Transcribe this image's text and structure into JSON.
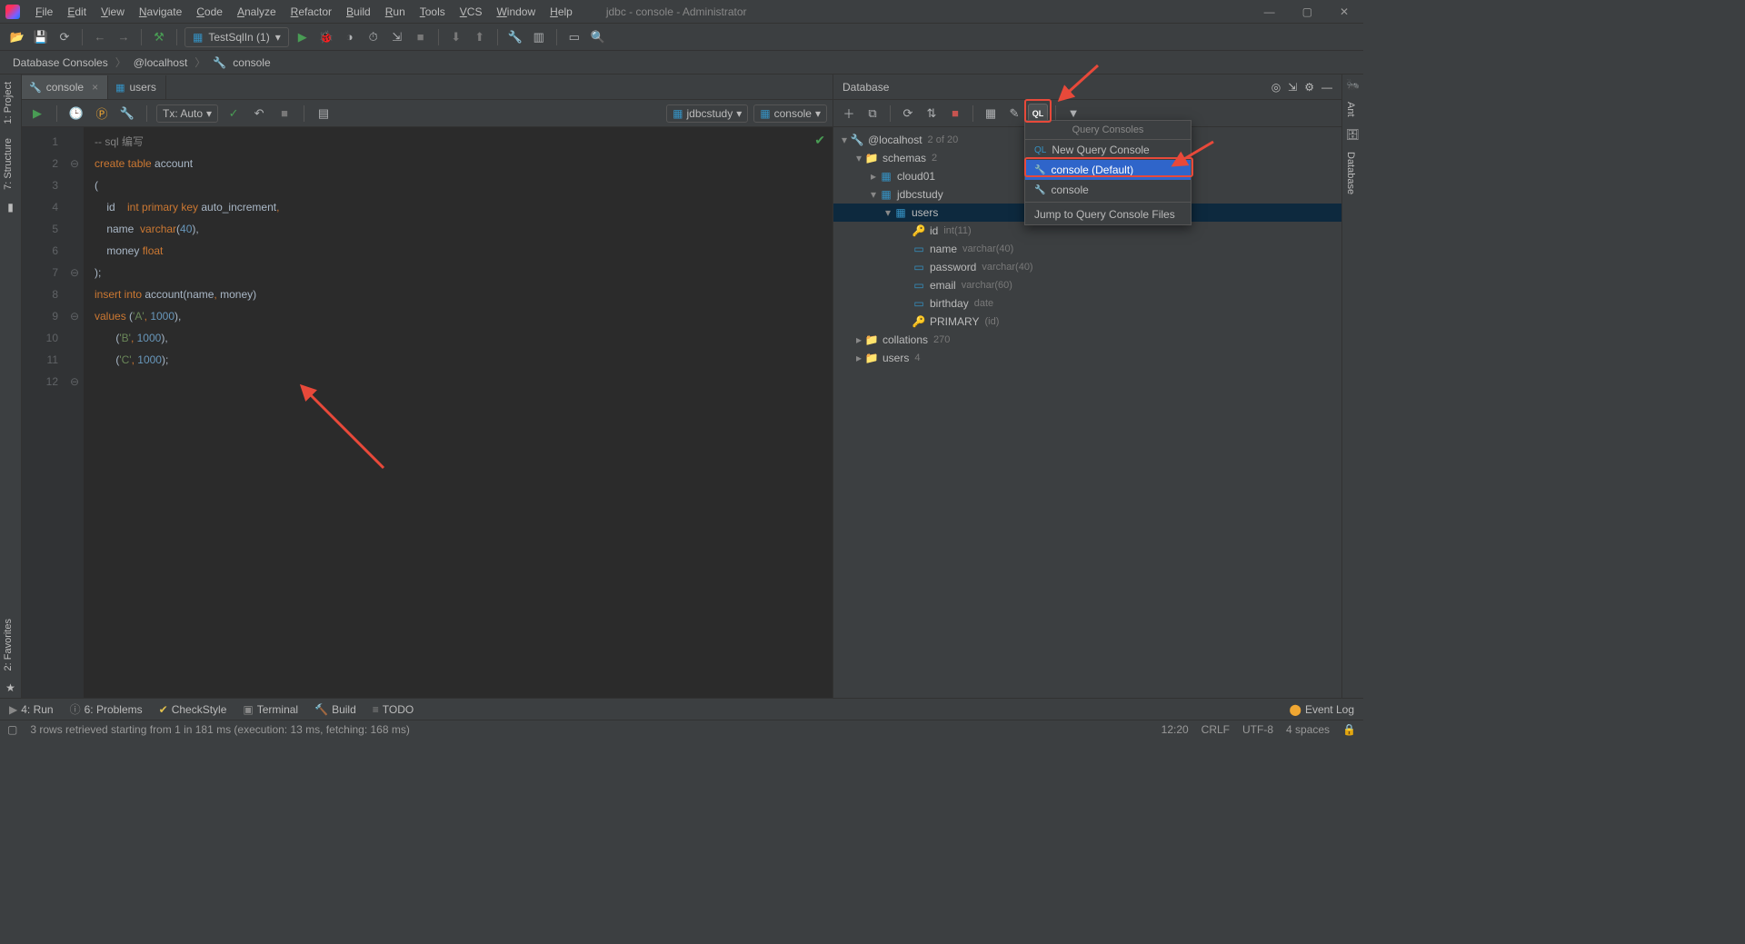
{
  "window": {
    "title": "jdbc - console - Administrator"
  },
  "menu": {
    "items": [
      "File",
      "Edit",
      "View",
      "Navigate",
      "Code",
      "Analyze",
      "Refactor",
      "Build",
      "Run",
      "Tools",
      "VCS",
      "Window",
      "Help"
    ]
  },
  "toolbar": {
    "runconfig": "TestSqlIn (1)"
  },
  "breadcrumbs": [
    "Database Consoles",
    "@localhost",
    "console"
  ],
  "left_tabs": [
    "1: Project",
    "7: Structure",
    "2: Favorites"
  ],
  "right_tabs": [
    "Ant",
    "Database"
  ],
  "editor_tabs": [
    {
      "label": "console",
      "icon": "sql",
      "active": true,
      "closable": true
    },
    {
      "label": "users",
      "icon": "table",
      "active": false,
      "closable": false
    }
  ],
  "editor_bar": {
    "tx": "Tx: Auto",
    "schema": "jdbcstudy",
    "console": "console"
  },
  "code_lines": [
    {
      "n": 1,
      "fold": "",
      "tokens": [
        [
          "cm",
          "-- sql 编写"
        ]
      ]
    },
    {
      "n": 2,
      "fold": "⊖",
      "tokens": [
        [
          "kw",
          "create table"
        ],
        [
          "id",
          " account"
        ]
      ]
    },
    {
      "n": 3,
      "fold": "",
      "tokens": [
        [
          "id",
          "("
        ]
      ]
    },
    {
      "n": 4,
      "fold": "",
      "tokens": [
        [
          "id",
          "    id    "
        ],
        [
          "kw",
          "int primary key"
        ],
        [
          "id",
          " auto_increment"
        ],
        [
          "kw",
          ","
        ]
      ]
    },
    {
      "n": 5,
      "fold": "",
      "tokens": [
        [
          "id",
          "    name  "
        ],
        [
          "kw",
          "varchar"
        ],
        [
          "id",
          "("
        ],
        [
          "num",
          "40"
        ],
        [
          "id",
          "),"
        ]
      ]
    },
    {
      "n": 6,
      "fold": "",
      "tokens": [
        [
          "id",
          "    money "
        ],
        [
          "kw",
          "float"
        ]
      ]
    },
    {
      "n": 7,
      "fold": "⊖",
      "tokens": [
        [
          "id",
          ");"
        ]
      ]
    },
    {
      "n": 8,
      "fold": "",
      "tokens": [
        [
          "id",
          ""
        ]
      ]
    },
    {
      "n": 9,
      "fold": "⊖",
      "tokens": [
        [
          "kw",
          "insert into"
        ],
        [
          "id",
          " account(name"
        ],
        [
          "kw",
          ","
        ],
        [
          "id",
          " money)"
        ]
      ]
    },
    {
      "n": 10,
      "fold": "",
      "tokens": [
        [
          "kw",
          "values"
        ],
        [
          "id",
          " ("
        ],
        [
          "str",
          "'A'"
        ],
        [
          "kw",
          ","
        ],
        [
          "id",
          " "
        ],
        [
          "num",
          "1000"
        ],
        [
          "id",
          "),"
        ]
      ]
    },
    {
      "n": 11,
      "fold": "",
      "tokens": [
        [
          "id",
          "       ("
        ],
        [
          "str",
          "'B'"
        ],
        [
          "kw",
          ","
        ],
        [
          "id",
          " "
        ],
        [
          "num",
          "1000"
        ],
        [
          "id",
          "),"
        ]
      ]
    },
    {
      "n": 12,
      "fold": "⊖",
      "tokens": [
        [
          "id",
          "       ("
        ],
        [
          "str",
          "'C'"
        ],
        [
          "kw",
          ","
        ],
        [
          "id",
          " "
        ],
        [
          "num",
          "1000"
        ],
        [
          "id",
          ");"
        ]
      ]
    }
  ],
  "db_panel": {
    "title": "Database",
    "root": {
      "label": "@localhost",
      "meta": "2 of 20"
    },
    "schemas": {
      "label": "schemas",
      "meta": "2"
    },
    "schema_list": [
      {
        "label": "cloud01",
        "expanded": false
      },
      {
        "label": "jdbcstudy",
        "expanded": true
      }
    ],
    "table": {
      "label": "users"
    },
    "columns": [
      {
        "name": "id",
        "type": "int(11)",
        "icon": "key"
      },
      {
        "name": "name",
        "type": "varchar(40)",
        "icon": "col"
      },
      {
        "name": "password",
        "type": "varchar(40)",
        "icon": "col"
      },
      {
        "name": "email",
        "type": "varchar(60)",
        "icon": "col"
      },
      {
        "name": "birthday",
        "type": "date",
        "icon": "col"
      }
    ],
    "primary": {
      "label": "PRIMARY",
      "meta": "(id)"
    },
    "collations": {
      "label": "collations",
      "meta": "270"
    },
    "users": {
      "label": "users",
      "meta": "4"
    }
  },
  "popup": {
    "title": "Query Consoles",
    "items": [
      {
        "label": "New Query Console",
        "icon": "sql-new"
      },
      {
        "label": "console (Default)",
        "icon": "sql",
        "selected": true
      },
      {
        "label": "console",
        "icon": "sql"
      }
    ],
    "footer": "Jump to Query Console Files"
  },
  "bottom_tabs": [
    {
      "label": "4: Run",
      "icon": "▶"
    },
    {
      "label": "6: Problems",
      "icon": "ⓘ"
    },
    {
      "label": "CheckStyle",
      "icon": "✔"
    },
    {
      "label": "Terminal",
      "icon": "▣"
    },
    {
      "label": "Build",
      "icon": "🔨"
    },
    {
      "label": "TODO",
      "icon": "≡"
    }
  ],
  "event_log": "Event Log",
  "status": {
    "msg": "3 rows retrieved starting from 1 in 181 ms (execution: 13 ms, fetching: 168 ms)",
    "time": "12:20",
    "eol": "CRLF",
    "enc": "UTF-8",
    "indent": "4 spaces"
  }
}
